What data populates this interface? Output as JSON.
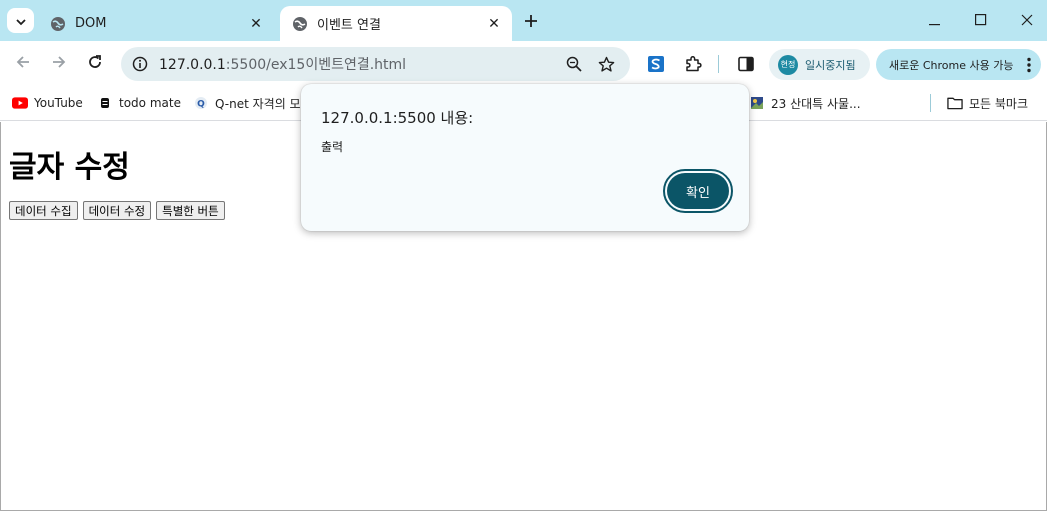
{
  "browser": {
    "tabs": [
      {
        "title": "DOM",
        "active": false
      },
      {
        "title": "이벤트 연결",
        "active": true
      }
    ],
    "omnibox": {
      "host": "127.0.0.1",
      "path": ":5500/ex15이벤트연결.html"
    },
    "profile_label": "일시중지됨",
    "profile_avatar_text": "현정",
    "update_label": "새로운 Chrome 사용 가능",
    "bookmarks": [
      {
        "label": "YouTube",
        "icon": "youtube-icon"
      },
      {
        "label": "todo mate",
        "icon": "todo-mate-icon"
      },
      {
        "label": "Q-net 자격의 모",
        "icon": "qnet-icon"
      },
      {
        "label": "23 산대특 사물...",
        "icon": "image-bookmark-icon"
      }
    ],
    "all_bookmarks_label": "모든 북마크"
  },
  "page": {
    "heading": "글자 수정",
    "buttons": [
      "데이터 수집",
      "데이터 수정",
      "특별한 버튼"
    ]
  },
  "dialog": {
    "title": "127.0.0.1:5500 내용:",
    "message": "출력",
    "ok_label": "확인"
  },
  "colors": {
    "tabstrip": "#b9e6f2",
    "dialog_button": "#0b5567"
  }
}
